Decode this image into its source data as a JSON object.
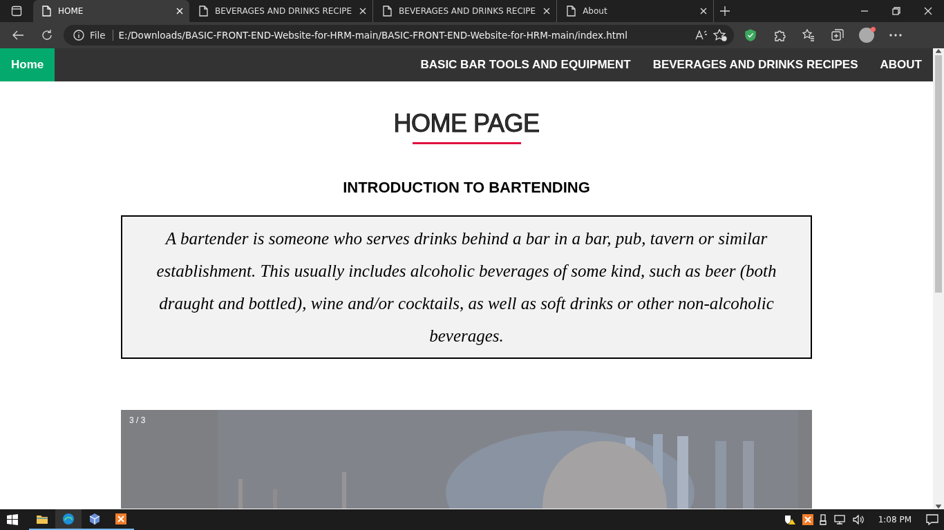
{
  "browser": {
    "tabs": [
      {
        "title": "HOME",
        "selected": true
      },
      {
        "title": "BEVERAGES AND DRINKS RECIPE",
        "selected": false
      },
      {
        "title": "BEVERAGES AND DRINKS RECIPE",
        "selected": false
      },
      {
        "title": "About",
        "selected": false
      }
    ],
    "address": {
      "scheme": "File",
      "url": "E:/Downloads/BASIC-FRONT-END-Website-for-HRM-main/BASIC-FRONT-END-Website-for-HRM-main/index.html"
    }
  },
  "nav": {
    "home": {
      "label": "Home",
      "selected": true
    },
    "links": [
      "BASIC BAR TOOLS AND EQUIPMENT",
      "BEVERAGES AND DRINKS RECIPES",
      "ABOUT"
    ]
  },
  "page": {
    "title": "HOME PAGE",
    "heading": "INTRODUCTION TO BARTENDING",
    "intro": "A bartender is someone who serves drinks behind a bar in a bar, pub, tavern or similar establishment. This usually includes alcoholic beverages of some kind, such as beer (both draught and bottled), wine and/or cocktails, as well as soft drinks or other non-alcoholic beverages.",
    "slideshow": {
      "counter": "3 / 3"
    }
  },
  "taskbar": {
    "time": "1:08 PM"
  }
}
